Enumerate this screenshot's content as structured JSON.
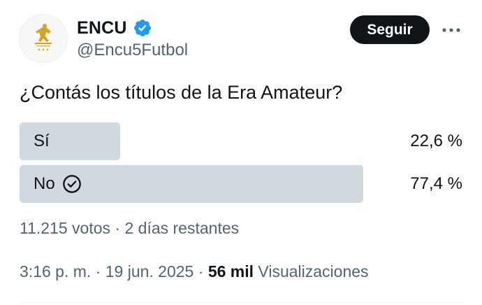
{
  "author": {
    "display_name": "ENCU",
    "handle": "@Encu5Futbol",
    "verified": true,
    "avatar_icon": "golden-player-crest-icon"
  },
  "actions": {
    "follow_label": "Seguir",
    "more_icon": "more-horizontal-icon"
  },
  "tweet": {
    "question": "¿Contás los títulos de la Era Amateur?"
  },
  "poll": {
    "options": [
      {
        "label": "Sí",
        "percent_text": "22,6 %",
        "percent": 22.6,
        "winner": false
      },
      {
        "label": "No",
        "percent_text": "77,4 %",
        "percent": 77.4,
        "winner": true
      }
    ],
    "votes_text": "11.215 votos",
    "separator": "·",
    "remaining_text": "2 días restantes"
  },
  "meta": {
    "time": "3:16 p. m.",
    "separator": "·",
    "date": "19 jun. 2025",
    "views_count": "56 mil",
    "views_label": "Visualizaciones"
  },
  "colors": {
    "text": "#0f1419",
    "secondary": "#536471",
    "poll_fill": "#cfd9de",
    "verified_blue": "#1d9bf0",
    "avatar_gold": "#d4a520"
  }
}
